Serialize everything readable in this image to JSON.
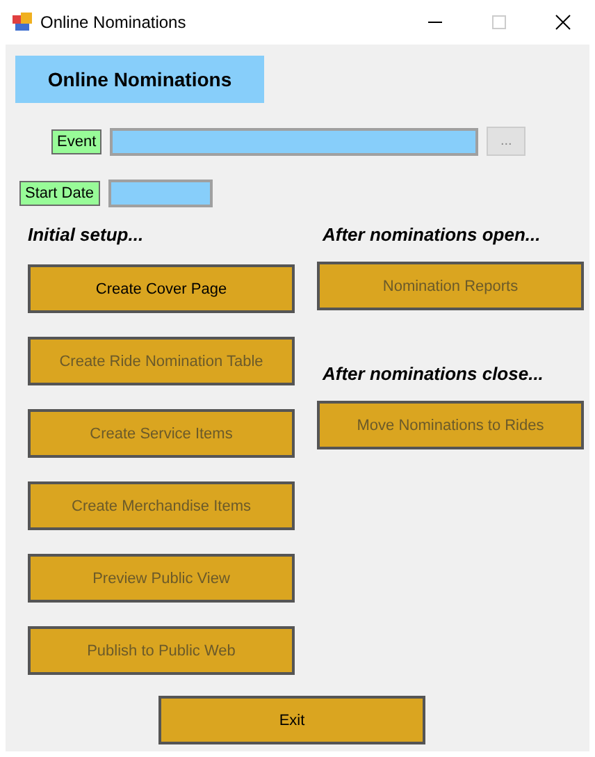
{
  "window": {
    "title": "Online Nominations"
  },
  "header": "Online Nominations",
  "event": {
    "label": "Event",
    "browse": "..."
  },
  "start_date": {
    "label": "Start Date"
  },
  "left": {
    "heading": "Initial setup...",
    "buttons": [
      {
        "label": "Create Cover Page",
        "disabled": false
      },
      {
        "label": "Create Ride Nomination Table",
        "disabled": true
      },
      {
        "label": "Create Service Items",
        "disabled": true
      },
      {
        "label": "Create Merchandise Items",
        "disabled": true
      },
      {
        "label": "Preview Public View",
        "disabled": true
      },
      {
        "label": "Publish to Public Web",
        "disabled": true
      }
    ]
  },
  "right": [
    {
      "heading": "After nominations open...",
      "button": {
        "label": "Nomination Reports",
        "disabled": true
      }
    },
    {
      "heading": "After nominations close...",
      "button": {
        "label": "Move Nominations to Rides",
        "disabled": true
      }
    }
  ],
  "exit": {
    "label": "Exit",
    "disabled": false
  }
}
